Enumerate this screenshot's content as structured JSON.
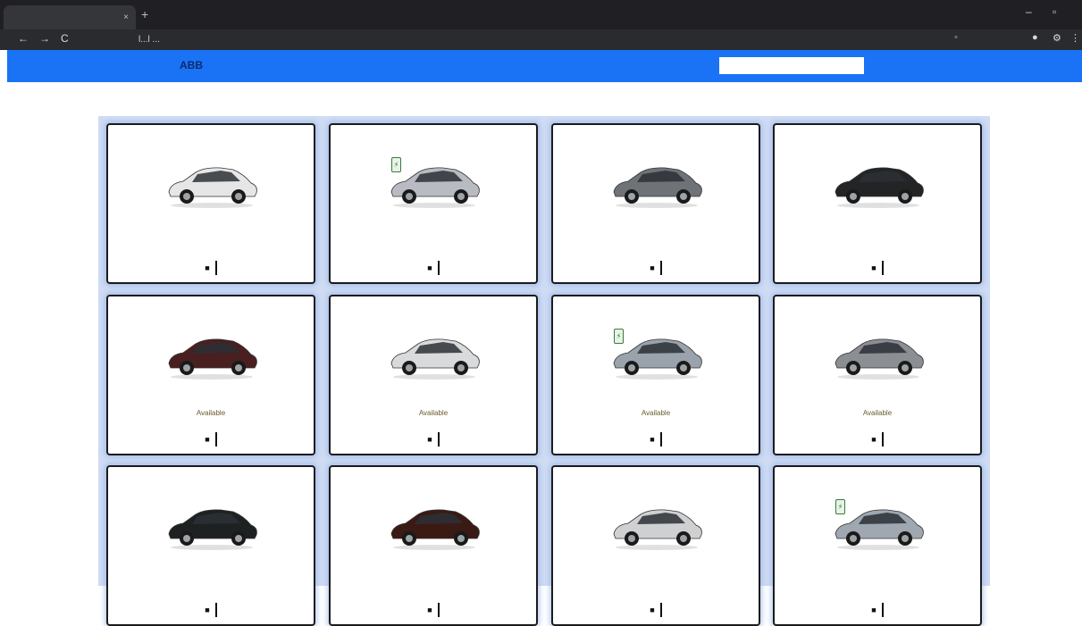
{
  "browser": {
    "tab_label": "",
    "tab_close": "×",
    "newtab_symbol": "+",
    "address": "l...l ...",
    "back_symbol": "←",
    "forward_symbol": "→",
    "reload_symbol": "C"
  },
  "header": {
    "brand": "ABB",
    "brand_sub": "",
    "filter_label": "",
    "search_placeholder": "",
    "link_label": ""
  },
  "cards": [
    {
      "title": "",
      "price": "",
      "status": "",
      "ev": false
    },
    {
      "title": "",
      "price": "",
      "status": "",
      "ev": true
    },
    {
      "title": "",
      "price": "",
      "status": "",
      "ev": false
    },
    {
      "title": "",
      "price": "",
      "status": "",
      "ev": false
    },
    {
      "title": "",
      "price": "",
      "status": "Available",
      "ev": false
    },
    {
      "title": "",
      "price": "",
      "status": "Available",
      "ev": false
    },
    {
      "title": "",
      "price": "",
      "status": "Available",
      "ev": true
    },
    {
      "title": "",
      "price": "",
      "status": "Available",
      "ev": false
    },
    {
      "title": "",
      "price": "",
      "status": "",
      "ev": false
    },
    {
      "title": "",
      "price": "",
      "status": "",
      "ev": false
    },
    {
      "title": "",
      "price": "",
      "status": "",
      "ev": false
    },
    {
      "title": "",
      "price": "",
      "status": "",
      "ev": true
    }
  ],
  "icons": {
    "delete": "trash-icon",
    "ev": "battery-icon"
  },
  "colors": {
    "appbar": "#1a73f5",
    "grid_bg": "#cfdcf3"
  }
}
